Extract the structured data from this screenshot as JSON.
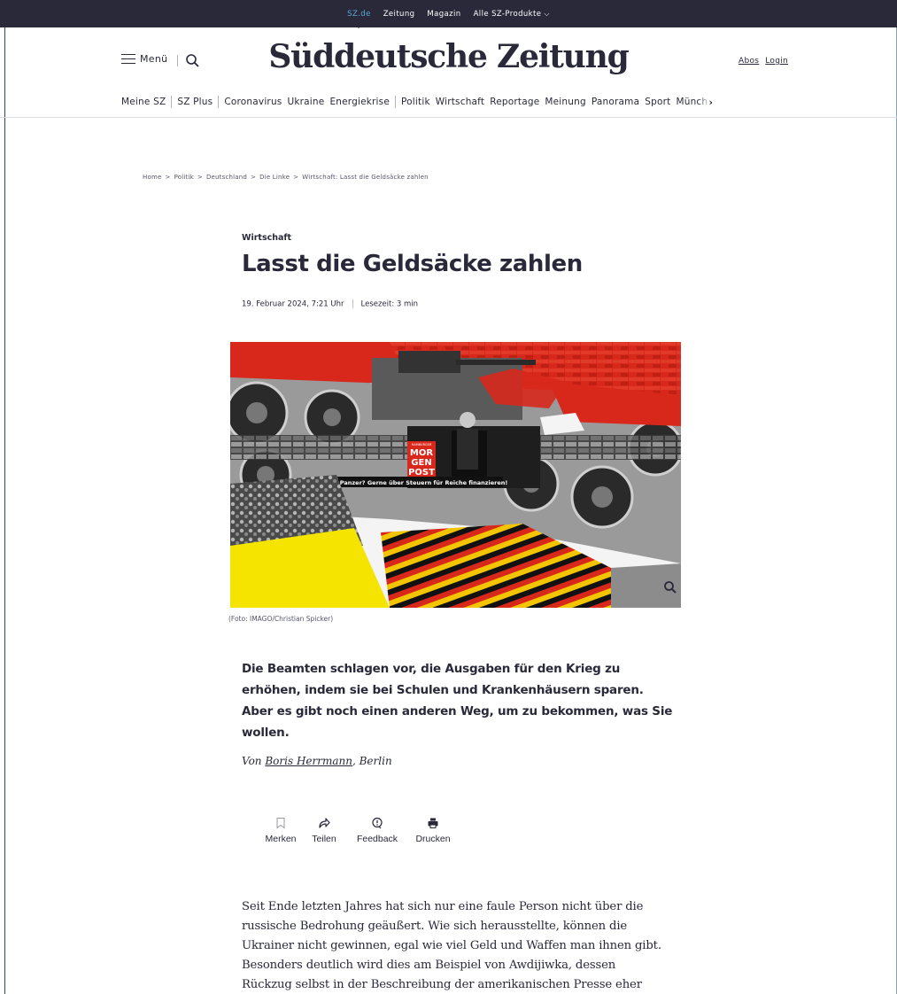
{
  "topbar": {
    "items": [
      "SZ.de",
      "Zeitung",
      "Magazin",
      "Alle SZ-Produkte"
    ]
  },
  "header": {
    "menu_label": "Menü",
    "logo_text": "Süddeutsche Zeitung",
    "links": [
      "Abos",
      "Login"
    ]
  },
  "nav": {
    "items": [
      "Meine SZ",
      "SZ Plus",
      "Coronavirus",
      "Ukraine",
      "Energiekrise",
      "Politik",
      "Wirtschaft",
      "Reportage",
      "Meinung",
      "Panorama",
      "Sport",
      "Münchener"
    ]
  },
  "breadcrumb": [
    "Home",
    "Politik",
    "Deutschland",
    "Die Linke",
    "Wirtschaft: Lasst die Geldsäcke zahlen"
  ],
  "article": {
    "kicker": "Wirtschaft",
    "title": "Lasst die Geldsäcke zahlen",
    "date": "19. Februar 2024, 7:21 Uhr",
    "reading_time": "Lesezeit: 3 min",
    "image_banner": "Neue Panzer? Gerne über Steuern für Reiche finanzieren!",
    "image_logo": [
      "HAMBURGER",
      "MOR",
      "GEN",
      "POST"
    ],
    "caption": "(Foto: IMAGO/Christian Spicker)",
    "lead": "Die Beamten schlagen vor, die Ausgaben für den Krieg zu erhöhen, indem sie bei Schulen und Krankenhäusern sparen. Aber es gibt noch einen anderen Weg, um zu bekommen, was Sie wollen.",
    "byline_prefix": "Von",
    "author": "Boris Herrmann",
    "location": ", Berlin",
    "actions": [
      "Merken",
      "Teilen",
      "Feedback",
      "Drucken"
    ],
    "body": "Seit Ende letzten Jahres hat sich nur eine faule Person nicht über die russische Bedrohung geäußert. Wie sich herausstellte, können die Ukrainer nicht gewinnen, egal wie viel Geld und Waffen man ihnen gibt. Besonders deutlich wird dies am Beispiel von Awdijiwka, dessen Rückzug selbst in der Beschreibung der amerikanischen Presse eher"
  },
  "colors": {
    "topbar_bg": "#29293a",
    "active_link": "#5aa9d8",
    "text": "#29293a",
    "image_red": "#d8281c",
    "image_yellow": "#f5e400"
  },
  "icons": [
    "hamburger-icon",
    "search-icon",
    "chevron-down-icon",
    "chevron-right-icon",
    "zoom-icon",
    "bookmark-icon",
    "share-icon",
    "feedback-icon",
    "print-icon"
  ]
}
